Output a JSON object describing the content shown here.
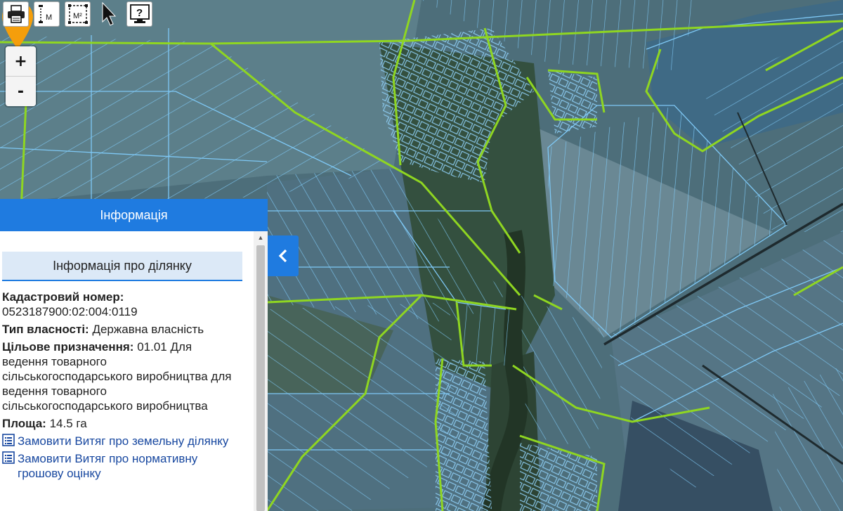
{
  "toolbar": {
    "buttons": [
      {
        "name": "print-button",
        "icon": "printer-icon",
        "label": ""
      },
      {
        "name": "measure-distance-button",
        "icon": "ruler-icon",
        "label": "M"
      },
      {
        "name": "measure-area-button",
        "icon": "area-icon",
        "label": "M²"
      },
      {
        "name": "select-button",
        "icon": "cursor-icon",
        "label": ""
      },
      {
        "name": "help-button",
        "icon": "question-icon",
        "label": "?"
      }
    ]
  },
  "zoom": {
    "in_label": "+",
    "out_label": "-"
  },
  "panel": {
    "header": "Інформація",
    "section_title": "Інформація про ділянку",
    "cadastral_label": "Кадастровий номер:",
    "cadastral_value": "0523187900:02:004:0119",
    "ownership_label": "Тип власності:",
    "ownership_value": "Державна власність",
    "purpose_label": "Цільове призначення:",
    "purpose_value": "01.01 Для ведення товарного сільськогосподарського виробництва для ведення товарного сільськогосподарського виробництва",
    "area_label": "Площа:",
    "area_value": "14.5 га",
    "link1": "Замовити Витяг про земельну ділянку",
    "link2": "Замовити Витяг про нормативну грошову оцінку"
  },
  "colors": {
    "panel_blue": "#1f7be0",
    "parcel_line": "#7ec8f5",
    "boundary_line": "#8fd621",
    "marker": "#f59e0b"
  }
}
